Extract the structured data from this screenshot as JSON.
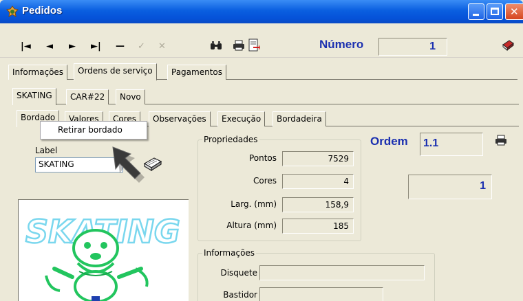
{
  "window": {
    "title": "Pedidos"
  },
  "toolbar": {
    "numero_label": "Número",
    "numero_value": "1",
    "nav": {
      "first": "|◄",
      "prev": "◄",
      "next": "►",
      "last": "►|",
      "delete": "—",
      "confirm": "✓",
      "cancel": "✕"
    }
  },
  "main_tabs": [
    {
      "label": "Informações",
      "active": false
    },
    {
      "label": "Ordens de serviço",
      "active": true
    },
    {
      "label": "Pagamentos",
      "active": false
    }
  ],
  "order_tabs": [
    {
      "label": "SKATING",
      "active": true
    },
    {
      "label": "CAR#22",
      "active": false
    },
    {
      "label": "Novo",
      "active": false
    }
  ],
  "detail_tabs": [
    {
      "label": "Bordado",
      "active": true
    },
    {
      "label": "Valores",
      "active": false
    },
    {
      "label": "Cores",
      "active": false
    },
    {
      "label": "Observações",
      "active": false
    },
    {
      "label": "Execução",
      "active": false
    },
    {
      "label": "Bordadeira",
      "active": false
    }
  ],
  "context_menu": {
    "item": "Retirar bordado"
  },
  "label_field": {
    "caption": "Label",
    "value": "SKATING"
  },
  "design": {
    "text": "SKATING"
  },
  "propriedades": {
    "title": "Propriedades",
    "rows": [
      {
        "label": "Pontos",
        "value": "7529"
      },
      {
        "label": "Cores",
        "value": "4"
      },
      {
        "label": "Larg. (mm)",
        "value": "158,9"
      },
      {
        "label": "Altura (mm)",
        "value": "185"
      }
    ]
  },
  "informacoes": {
    "title": "Informações",
    "rows": [
      {
        "label": "Disquete",
        "value": ""
      },
      {
        "label": "Bastidor",
        "value": ""
      }
    ]
  },
  "ordem": {
    "label": "Ordem",
    "value": "1.1",
    "count": "1"
  },
  "colors": {
    "accent_blue": "#1b30b0",
    "embroidery_green": "#22c55e",
    "embroidery_cyan": "#7ad7ee"
  }
}
